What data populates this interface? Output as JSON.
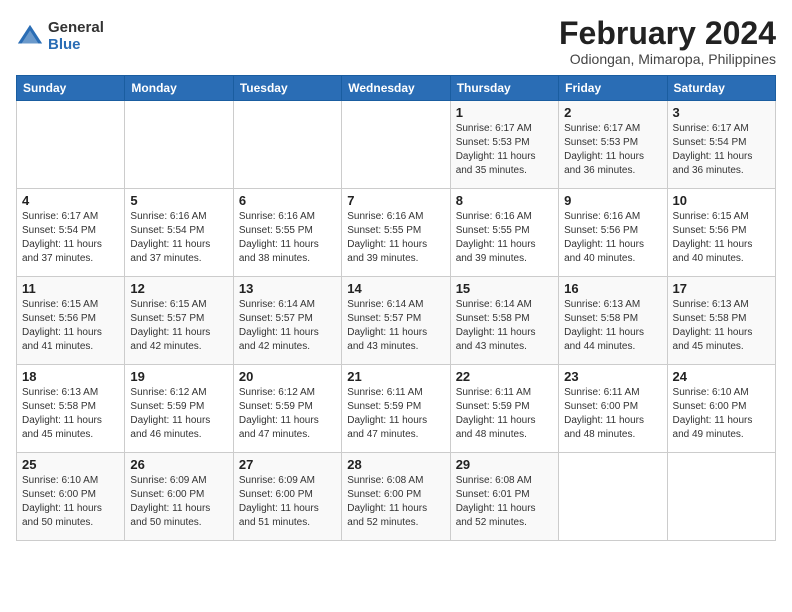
{
  "logo": {
    "general": "General",
    "blue": "Blue"
  },
  "title": "February 2024",
  "subtitle": "Odiongan, Mimaropa, Philippines",
  "days_of_week": [
    "Sunday",
    "Monday",
    "Tuesday",
    "Wednesday",
    "Thursday",
    "Friday",
    "Saturday"
  ],
  "weeks": [
    [
      {
        "day": "",
        "info": ""
      },
      {
        "day": "",
        "info": ""
      },
      {
        "day": "",
        "info": ""
      },
      {
        "day": "",
        "info": ""
      },
      {
        "day": "1",
        "info": "Sunrise: 6:17 AM\nSunset: 5:53 PM\nDaylight: 11 hours and 35 minutes."
      },
      {
        "day": "2",
        "info": "Sunrise: 6:17 AM\nSunset: 5:53 PM\nDaylight: 11 hours and 36 minutes."
      },
      {
        "day": "3",
        "info": "Sunrise: 6:17 AM\nSunset: 5:54 PM\nDaylight: 11 hours and 36 minutes."
      }
    ],
    [
      {
        "day": "4",
        "info": "Sunrise: 6:17 AM\nSunset: 5:54 PM\nDaylight: 11 hours and 37 minutes."
      },
      {
        "day": "5",
        "info": "Sunrise: 6:16 AM\nSunset: 5:54 PM\nDaylight: 11 hours and 37 minutes."
      },
      {
        "day": "6",
        "info": "Sunrise: 6:16 AM\nSunset: 5:55 PM\nDaylight: 11 hours and 38 minutes."
      },
      {
        "day": "7",
        "info": "Sunrise: 6:16 AM\nSunset: 5:55 PM\nDaylight: 11 hours and 39 minutes."
      },
      {
        "day": "8",
        "info": "Sunrise: 6:16 AM\nSunset: 5:55 PM\nDaylight: 11 hours and 39 minutes."
      },
      {
        "day": "9",
        "info": "Sunrise: 6:16 AM\nSunset: 5:56 PM\nDaylight: 11 hours and 40 minutes."
      },
      {
        "day": "10",
        "info": "Sunrise: 6:15 AM\nSunset: 5:56 PM\nDaylight: 11 hours and 40 minutes."
      }
    ],
    [
      {
        "day": "11",
        "info": "Sunrise: 6:15 AM\nSunset: 5:56 PM\nDaylight: 11 hours and 41 minutes."
      },
      {
        "day": "12",
        "info": "Sunrise: 6:15 AM\nSunset: 5:57 PM\nDaylight: 11 hours and 42 minutes."
      },
      {
        "day": "13",
        "info": "Sunrise: 6:14 AM\nSunset: 5:57 PM\nDaylight: 11 hours and 42 minutes."
      },
      {
        "day": "14",
        "info": "Sunrise: 6:14 AM\nSunset: 5:57 PM\nDaylight: 11 hours and 43 minutes."
      },
      {
        "day": "15",
        "info": "Sunrise: 6:14 AM\nSunset: 5:58 PM\nDaylight: 11 hours and 43 minutes."
      },
      {
        "day": "16",
        "info": "Sunrise: 6:13 AM\nSunset: 5:58 PM\nDaylight: 11 hours and 44 minutes."
      },
      {
        "day": "17",
        "info": "Sunrise: 6:13 AM\nSunset: 5:58 PM\nDaylight: 11 hours and 45 minutes."
      }
    ],
    [
      {
        "day": "18",
        "info": "Sunrise: 6:13 AM\nSunset: 5:58 PM\nDaylight: 11 hours and 45 minutes."
      },
      {
        "day": "19",
        "info": "Sunrise: 6:12 AM\nSunset: 5:59 PM\nDaylight: 11 hours and 46 minutes."
      },
      {
        "day": "20",
        "info": "Sunrise: 6:12 AM\nSunset: 5:59 PM\nDaylight: 11 hours and 47 minutes."
      },
      {
        "day": "21",
        "info": "Sunrise: 6:11 AM\nSunset: 5:59 PM\nDaylight: 11 hours and 47 minutes."
      },
      {
        "day": "22",
        "info": "Sunrise: 6:11 AM\nSunset: 5:59 PM\nDaylight: 11 hours and 48 minutes."
      },
      {
        "day": "23",
        "info": "Sunrise: 6:11 AM\nSunset: 6:00 PM\nDaylight: 11 hours and 48 minutes."
      },
      {
        "day": "24",
        "info": "Sunrise: 6:10 AM\nSunset: 6:00 PM\nDaylight: 11 hours and 49 minutes."
      }
    ],
    [
      {
        "day": "25",
        "info": "Sunrise: 6:10 AM\nSunset: 6:00 PM\nDaylight: 11 hours and 50 minutes."
      },
      {
        "day": "26",
        "info": "Sunrise: 6:09 AM\nSunset: 6:00 PM\nDaylight: 11 hours and 50 minutes."
      },
      {
        "day": "27",
        "info": "Sunrise: 6:09 AM\nSunset: 6:00 PM\nDaylight: 11 hours and 51 minutes."
      },
      {
        "day": "28",
        "info": "Sunrise: 6:08 AM\nSunset: 6:00 PM\nDaylight: 11 hours and 52 minutes."
      },
      {
        "day": "29",
        "info": "Sunrise: 6:08 AM\nSunset: 6:01 PM\nDaylight: 11 hours and 52 minutes."
      },
      {
        "day": "",
        "info": ""
      },
      {
        "day": "",
        "info": ""
      }
    ]
  ]
}
